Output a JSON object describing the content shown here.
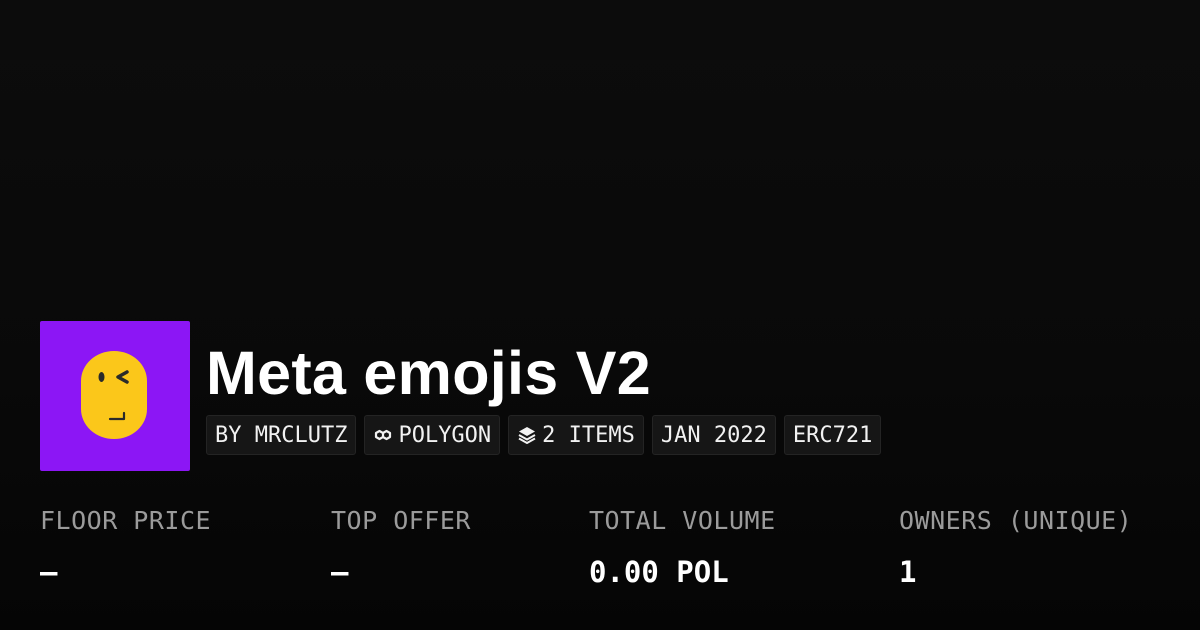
{
  "collection": {
    "title": "Meta emojis V2",
    "avatar_background": "#8c16f5",
    "avatar_icon": "winking-emoji-icon"
  },
  "badges": {
    "creator": "BY MRCLUTZ",
    "chain": "POLYGON",
    "chain_icon": "chain-link-icon",
    "items": "2 ITEMS",
    "items_icon": "layers-icon",
    "date": "JAN 2022",
    "standard": "ERC721"
  },
  "stats": [
    {
      "label": "FLOOR PRICE",
      "value": "–"
    },
    {
      "label": "TOP OFFER",
      "value": "–"
    },
    {
      "label": "TOTAL VOLUME",
      "value": "0.00 POL"
    },
    {
      "label": "OWNERS (UNIQUE)",
      "value": "1"
    }
  ],
  "colors": {
    "background": "#0a0a0a",
    "accent_purple": "#8c16f5",
    "emoji_yellow": "#fbc71a",
    "label_gray": "#9b9b9b"
  }
}
